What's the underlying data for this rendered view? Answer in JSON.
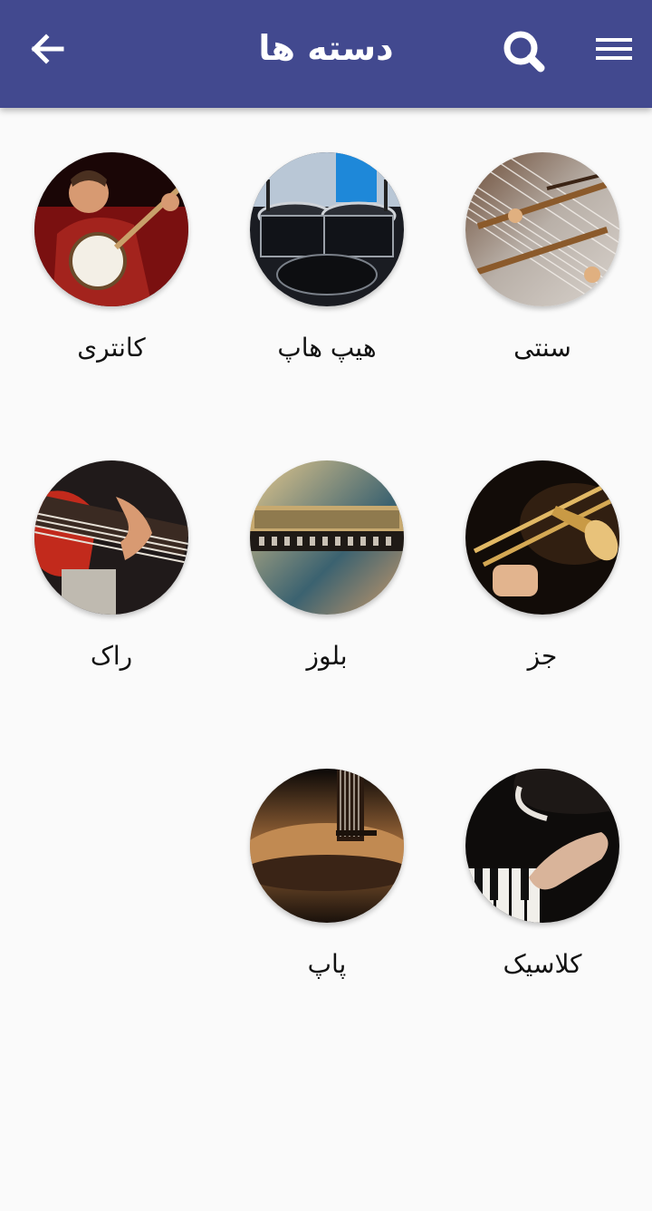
{
  "header": {
    "title": "دسته ها",
    "background": "#42498f",
    "icons": {
      "back": "arrow-left-icon",
      "search": "search-icon",
      "menu": "hamburger-menu-icon"
    }
  },
  "categories": [
    {
      "label": "سنتی",
      "image": "santur-icon"
    },
    {
      "label": "هیپ هاپ",
      "image": "drum-kit-icon"
    },
    {
      "label": "کانتری",
      "image": "banjo-player-icon"
    },
    {
      "label": "جز",
      "image": "trombone-icon"
    },
    {
      "label": "بلوز",
      "image": "harmonica-icon"
    },
    {
      "label": "راک",
      "image": "bass-guitar-icon"
    },
    {
      "label": "کلاسیک",
      "image": "piano-icon"
    },
    {
      "label": "پاپ",
      "image": "acoustic-guitar-icon"
    }
  ]
}
